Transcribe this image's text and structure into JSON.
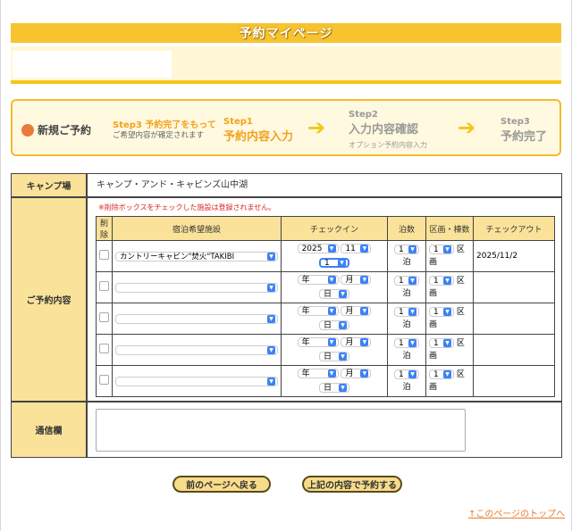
{
  "page_title": "予約マイページ",
  "steps": {
    "new_reservation": "新規ご予約",
    "note_line1": "Step3 予約完了をもって",
    "note_line2": "ご希望内容が確定されます",
    "step1_num": "Step1",
    "step1_label": "予約内容入力",
    "step2_num": "Step2",
    "step2_label": "入力内容確認",
    "step2_sub": "オプション予約内容入力",
    "step3_num": "Step3",
    "step3_label": "予約完了"
  },
  "form": {
    "camp_label": "キャンプ場",
    "camp_value": "キャンプ・アンド・キャビンズ山中湖",
    "reservation_label": "ご予約内容",
    "warning": "※削除ボックスをチェックした施設は登録されません。",
    "columns": [
      "削除",
      "宿泊希望施設",
      "チェックイン",
      "泊数",
      "区画・棟数",
      "チェックアウト"
    ],
    "rows": [
      {
        "facility": "カントリーキャビン\"焚火\"TAKIBI",
        "year": "2025",
        "month": "11",
        "day": "1",
        "nights": "1",
        "nights_unit": "泊",
        "units": "1",
        "units_unit": "区画",
        "checkout": "2025/11/2"
      },
      {
        "facility": "",
        "year": "年",
        "month": "月",
        "day": "日",
        "nights": "1",
        "nights_unit": "泊",
        "units": "1",
        "units_unit": "区画",
        "checkout": ""
      },
      {
        "facility": "",
        "year": "年",
        "month": "月",
        "day": "日",
        "nights": "1",
        "nights_unit": "泊",
        "units": "1",
        "units_unit": "区画",
        "checkout": ""
      },
      {
        "facility": "",
        "year": "年",
        "month": "月",
        "day": "日",
        "nights": "1",
        "nights_unit": "泊",
        "units": "1",
        "units_unit": "区画",
        "checkout": ""
      },
      {
        "facility": "",
        "year": "年",
        "month": "月",
        "day": "日",
        "nights": "1",
        "nights_unit": "泊",
        "units": "1",
        "units_unit": "区画",
        "checkout": ""
      }
    ],
    "message_label": "通信欄"
  },
  "buttons": {
    "back": "前のページへ戻る",
    "submit": "上記の内容で予約する"
  },
  "top_link": "↑このページのトップへ"
}
